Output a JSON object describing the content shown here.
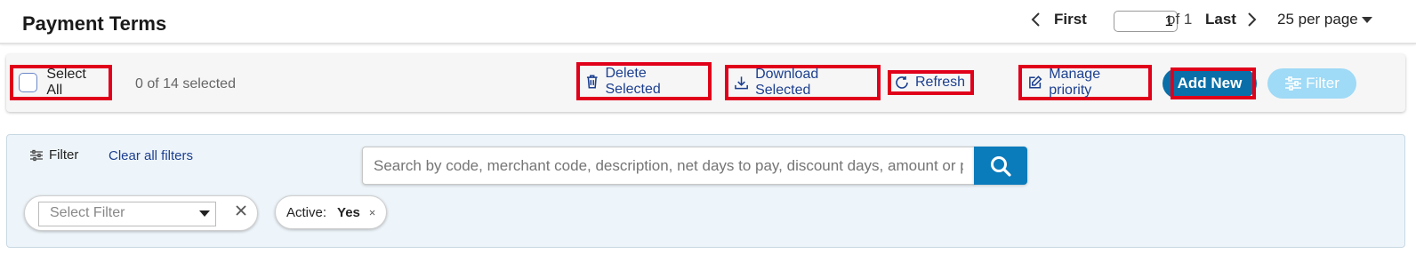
{
  "header": {
    "title": "Payment Terms",
    "pagination": {
      "first_label": "First",
      "current_page": "1",
      "of_label": "of 1",
      "last_label": "Last",
      "per_page_label": "25 per page"
    }
  },
  "toolbar": {
    "select_all_label": "Select All",
    "selected_count": "0 of 14 selected",
    "delete_label": "Delete Selected",
    "download_label": "Download Selected",
    "refresh_label": "Refresh",
    "manage_priority_label": "Manage priority",
    "add_new_label": "Add New",
    "filter_label": "Filter"
  },
  "filter_panel": {
    "filter_label": "Filter",
    "clear_all_label": "Clear all filters",
    "search_placeholder": "Search by code, merchant code, description, net days to pay, discount days, amount or percent",
    "select_filter_placeholder": "Select Filter",
    "chips": [
      {
        "key": "Active:",
        "value": "Yes"
      }
    ]
  },
  "colors": {
    "accent": "#0a6fa8",
    "highlight_border": "#e0001a",
    "link": "#1c3f8f"
  }
}
